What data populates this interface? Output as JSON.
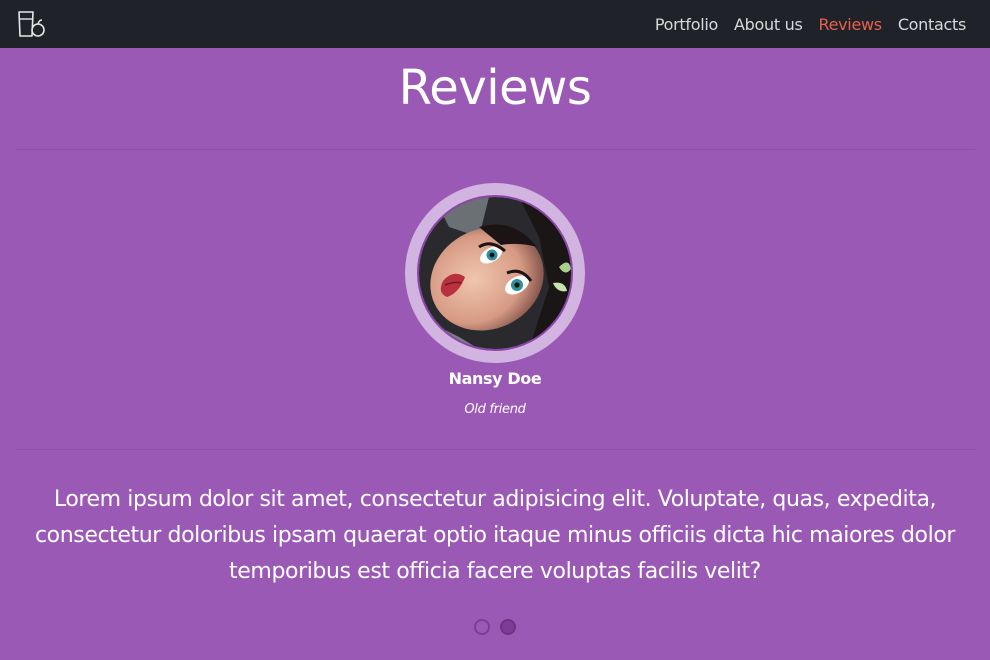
{
  "nav": {
    "logo_icon": "glass-apple-logo-icon",
    "links": [
      {
        "label": "Portfolio",
        "active": false
      },
      {
        "label": "About us",
        "active": false
      },
      {
        "label": "Reviews",
        "active": true
      },
      {
        "label": "Contacts",
        "active": false
      }
    ]
  },
  "section": {
    "title": "Reviews"
  },
  "review": {
    "avatar_icon": "reviewer-portrait",
    "name": "Nansy Doe",
    "role": "Old friend",
    "text": "Lorem ipsum dolor sit amet, consectetur adipisicing elit. Voluptate, quas, expedita, consectetur doloribus ipsam quaerat optio itaque minus officiis dicta hic maiores dolor temporibus est officia facere voluptas facilis velit?"
  },
  "pagination": {
    "total": 2,
    "active_index": 1
  },
  "colors": {
    "background": "#9b59b6",
    "navbar": "#1f2228",
    "nav_active": "#e8604c",
    "text": "#ffffff"
  }
}
